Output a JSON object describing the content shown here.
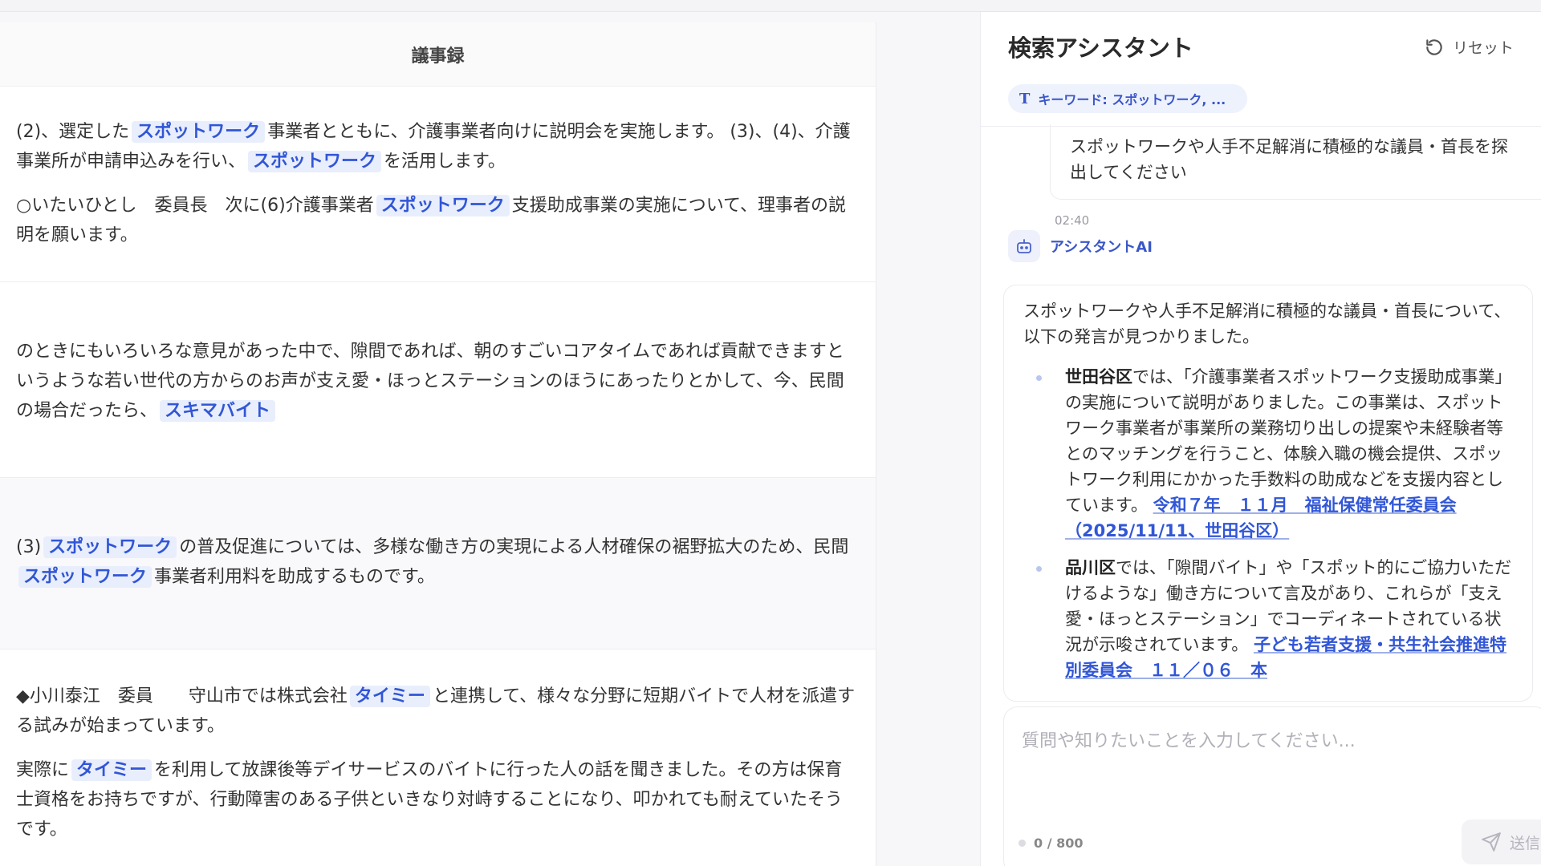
{
  "minutes": {
    "title": "議事録",
    "blocks": [
      {
        "paragraphs": [
          {
            "segments": [
              {
                "text": "(2)、選定した"
              },
              {
                "text": "スポットワーク",
                "highlight": true
              },
              {
                "text": "事業者とともに、介護事業者向けに説明会を実施します。 (3)、(4)、介護事業所が申請申込みを行い、"
              },
              {
                "text": "スポットワーク",
                "highlight": true
              },
              {
                "text": "を活用します。"
              }
            ]
          },
          {
            "segments": [
              {
                "text": "○いたいひとし　委員長　次に(6)介護事業者"
              },
              {
                "text": "スポットワーク",
                "highlight": true
              },
              {
                "text": "支援助成事業の実施について、理事者の説明を願います。"
              }
            ]
          }
        ]
      },
      {
        "paragraphs": [
          {
            "segments": [
              {
                "text": "のときにもいろいろな意見があった中で、隙間であれば、朝のすごいコアタイムであれば貢献できますというような若い世代の方からのお声が支え愛・ほっとステーションのほうにあったりとかして、今、民間の場合だったら、"
              },
              {
                "text": "スキマバイト",
                "highlight": true
              }
            ]
          }
        ]
      },
      {
        "paragraphs": [
          {
            "segments": [
              {
                "text": "(3)"
              },
              {
                "text": "スポットワーク",
                "highlight": true
              },
              {
                "text": "の普及促進については、多様な働き方の実現による人材確保の裾野拡大のため、民間"
              },
              {
                "text": "スポットワーク",
                "highlight": true
              },
              {
                "text": "事業者利用料を助成するものです。"
              }
            ]
          }
        ]
      },
      {
        "paragraphs": [
          {
            "segments": [
              {
                "text": "◆小川泰江　委員　　守山市では株式会社"
              },
              {
                "text": "タイミー",
                "highlight": true
              },
              {
                "text": "と連携して、様々な分野に短期バイトで人材を派遣する試みが始まっています。"
              }
            ]
          },
          {
            "segments": [
              {
                "text": "実際に"
              },
              {
                "text": "タイミー",
                "highlight": true
              },
              {
                "text": "を利用して放課後等デイサービスのバイトに行った人の話を聞きました。その方は保育士資格をお持ちですが、行動障害のある子供といきなり対峙することになり、叩かれても耐えていたそうです。"
              }
            ]
          }
        ]
      }
    ]
  },
  "assistant": {
    "title": "検索アシスタント",
    "reset_label": "リセット",
    "keyword_chip": "キーワード: スポットワーク, ...",
    "user_message_line1": "スポットワークや人手不足解消に積極的な議員・首長を探",
    "user_message_line2": "出してください",
    "user_time": "02:40",
    "ai_name": "アシスタントAI",
    "ai_intro": "スポットワークや人手不足解消に積極的な議員・首長について、以下の発言が見つかりました。",
    "items": [
      {
        "place": "世田谷区",
        "body": "では、「介護事業者スポットワーク支援助成事業」の実施について説明がありました。この事業は、スポットワーク事業者が事業所の業務切り出しの提案や未経験者等とのマッチングを行うこと、体験入職の機会提供、スポットワーク利用にかかった手数料の助成などを支援内容としています。",
        "ref": "令和７年　１１月　福祉保健常任委員会（2025/11/11、世田谷区）"
      },
      {
        "place": "品川区",
        "body": "では、「隙間バイト」や「スポット的にご協力いただけるような」働き方について言及があり、これらが「支え愛・ほっとステーション」でコーディネートされている状況が示唆されています。",
        "ref": "子ども若者支援・共生社会推進特別委員会　１１／０６　本"
      }
    ],
    "input_placeholder": "質問や知りたいことを入力してください...",
    "counter": "0 / 800",
    "send_label": "送信"
  },
  "colors": {
    "accent": "#3156d6",
    "highlight_bg": "#e9eefc",
    "panel_bg": "#ffffff",
    "page_bg": "#f7f7f9"
  },
  "icons": {
    "reset": "refresh-icon",
    "keyword": "text-t-icon",
    "ai_avatar": "robot-icon",
    "send": "paper-plane-icon"
  }
}
